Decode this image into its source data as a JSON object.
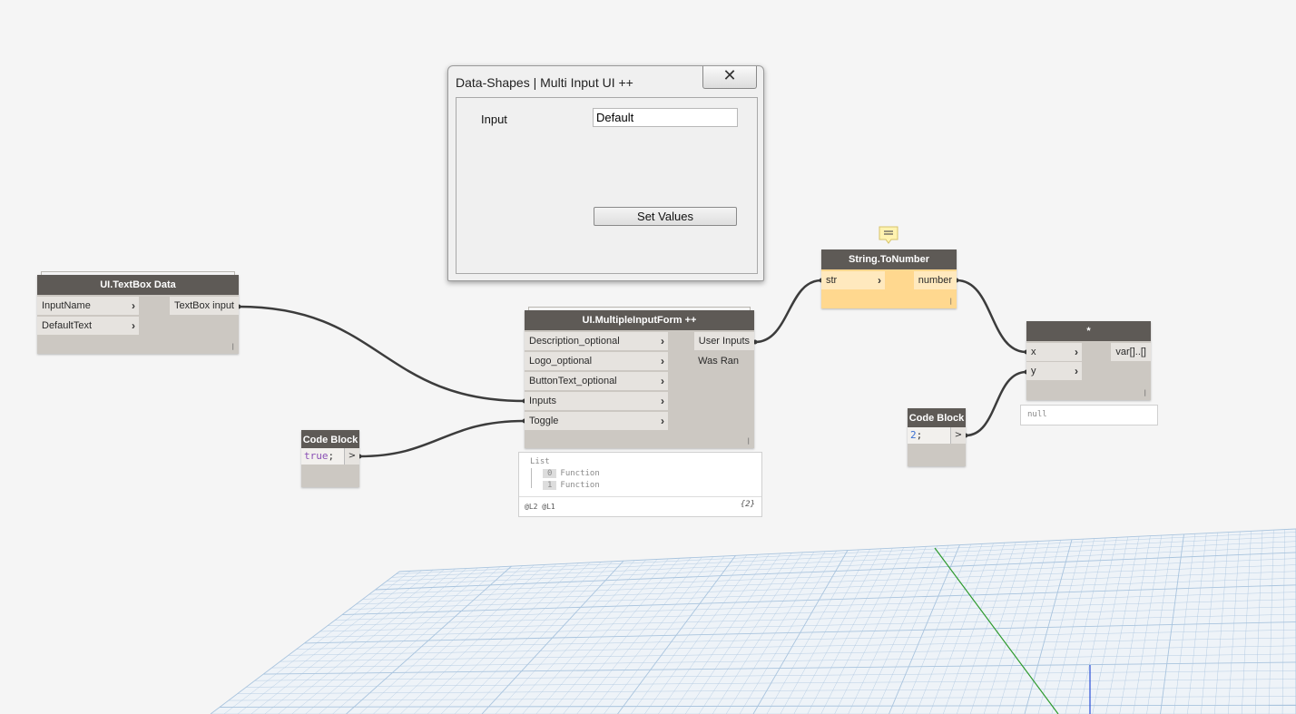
{
  "dialog": {
    "title": "Data-Shapes | Multi Input UI ++",
    "close_glyph": "✕",
    "input_label": "Input",
    "input_value": "Default",
    "button_label": "Set Values"
  },
  "nodes": {
    "textbox_data": {
      "title": "UI.TextBox Data",
      "inputs": [
        "InputName",
        "DefaultText"
      ],
      "output": "TextBox input"
    },
    "code_block_true": {
      "title": "Code Block",
      "code_value": "true",
      "code_suffix": ";",
      "out": ">"
    },
    "multi_input_form": {
      "title": "UI.MultipleInputForm ++",
      "inputs": [
        "Description_optional",
        "Logo_optional",
        "ButtonText_optional",
        "Inputs",
        "Toggle"
      ],
      "outputs": [
        "User Inputs",
        "Was Ran"
      ],
      "preview": {
        "header": "List",
        "items": [
          {
            "index": "0",
            "value": "Function"
          },
          {
            "index": "1",
            "value": "Function"
          }
        ],
        "footer_levels": "@L2 @L1",
        "footer_count": "{2}"
      }
    },
    "string_to_number": {
      "title": "String.ToNumber",
      "input": "str",
      "output": "number",
      "note_icon": "note-icon"
    },
    "multiply": {
      "title": "*",
      "inputs": [
        "x",
        "y"
      ],
      "output": "var[]..[]",
      "preview": "null"
    },
    "code_block_2": {
      "title": "Code Block",
      "code_value": "2",
      "code_suffix": ";",
      "out": ">"
    }
  },
  "colors": {
    "canvas": "#f5f5f5",
    "node_header": "#5e5a56",
    "node_body": "#ccc8c2",
    "selected_node": "#ffd88f",
    "wire": "#3c3c3c",
    "grid": "#a9c4de",
    "axis_green": "#2e9a2e",
    "axis_blue": "#2a50d8"
  }
}
